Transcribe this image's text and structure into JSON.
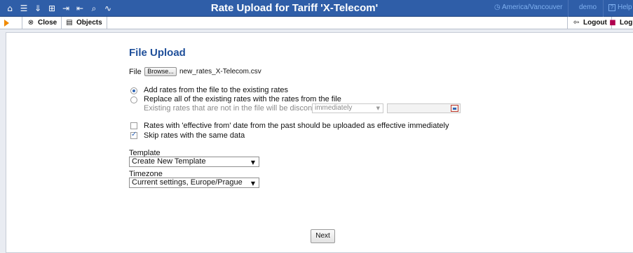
{
  "header": {
    "title": "Rate Upload for Tariff 'X-Telecom'",
    "timezone": "America/Vancouver",
    "user": "demo",
    "help": "Help",
    "icons": [
      "home-icon",
      "list-icon",
      "download-icon",
      "grid-icon",
      "import-icon",
      "export-icon",
      "search-icon",
      "chart-icon"
    ]
  },
  "toolbar": {
    "close_label": "Close",
    "objects_label": "Objects",
    "logout_label": "Logout",
    "log_label": "Log"
  },
  "form": {
    "heading": "File Upload",
    "file_label": "File",
    "browse_label": "Browse...",
    "file_name": "new_rates_X-Telecom.csv",
    "radio_add": "Add rates from the file to the existing rates",
    "radio_replace": "Replace all of the existing rates with the rates from the file",
    "discontinue_label": "Existing rates that are not in the file will be discontinued",
    "discontinue_value": "immediately",
    "date_value": "",
    "check_past": "Rates with 'effective from' date from the past should be uploaded as effective immediately",
    "check_skip": "Skip rates with the same data",
    "template_label": "Template",
    "template_value": "Create New Template",
    "timezone_label": "Timezone",
    "timezone_value": "Current settings, Europe/Prague",
    "next_label": "Next"
  },
  "state": {
    "selected_radio": "add",
    "check_past": false,
    "check_skip": true
  },
  "colors": {
    "header_bg": "#2f5ea8",
    "heading": "#1f4f9a",
    "accent": "#f08a00"
  }
}
